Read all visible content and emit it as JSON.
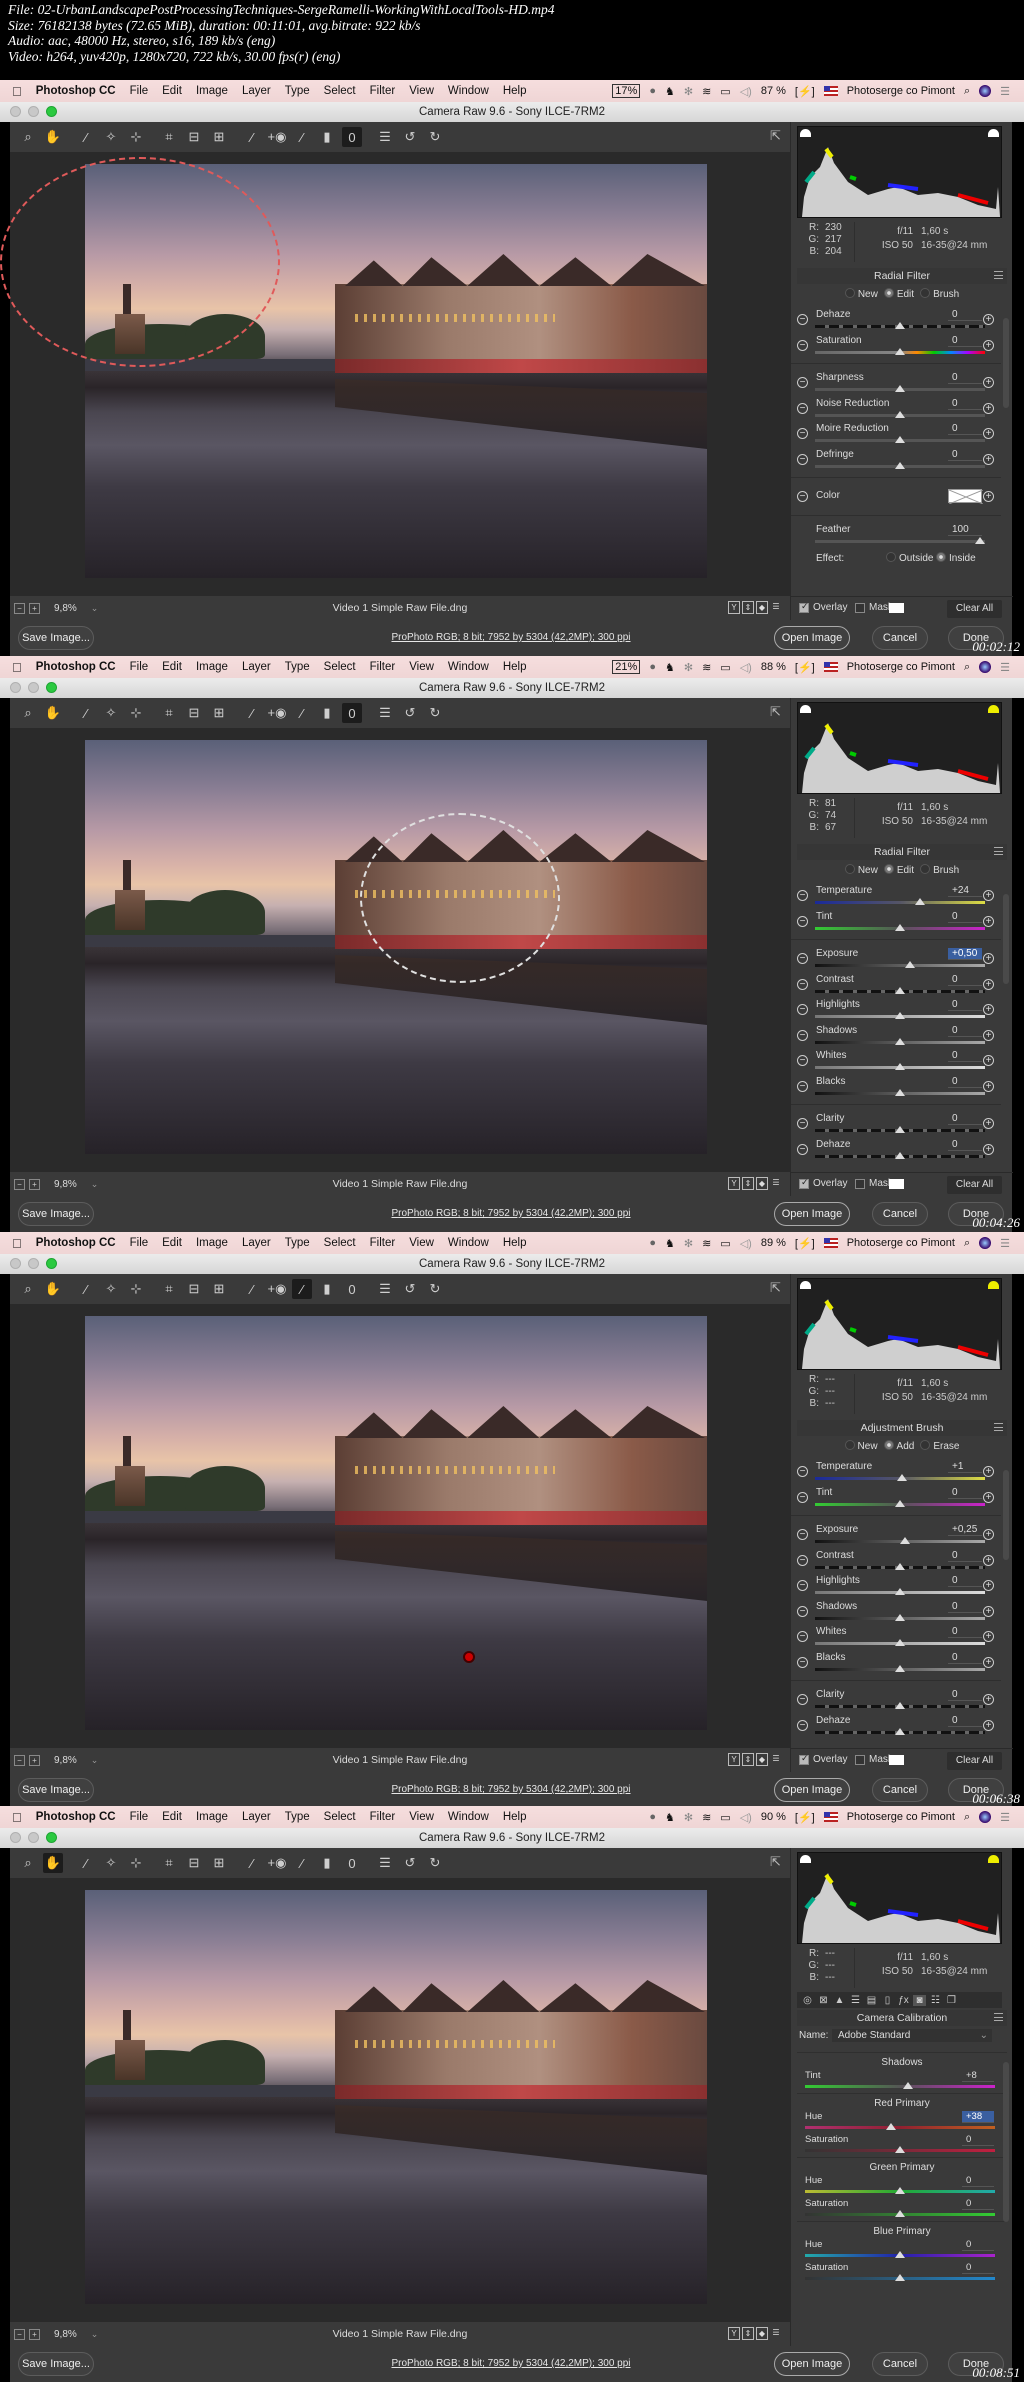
{
  "file_info": {
    "lines": [
      "File: 02-UrbanLandscapePostProcessingTechniques-SergeRamelli-WorkingWithLocalTools-HD.mp4",
      "Size: 76182138 bytes (72.65 MiB), duration: 00:11:01, avg.bitrate: 922 kb/s",
      "Audio: aac, 48000 Hz, stereo, s16, 189 kb/s (eng)",
      "Video: h264, yuv420p, 1280x720, 722 kb/s, 30.00 fps(r) (eng)"
    ]
  },
  "common": {
    "app_name": "Photoshop CC",
    "menu": [
      "File",
      "Edit",
      "Image",
      "Layer",
      "Type",
      "Select",
      "Filter",
      "View",
      "Window",
      "Help"
    ],
    "user": "Photoserge co Pimont",
    "window_title": "Camera Raw 9.6  -  Sony ILCE-7RM2",
    "zoom_level": "9,8%",
    "filename": "Video 1 Simple Raw File.dng",
    "workflow": "ProPhoto RGB; 8 bit; 7952 by 5304 (42,2MP); 300 ppi",
    "save_label": "Save Image...",
    "open_label": "Open Image",
    "cancel_label": "Cancel",
    "done_label": "Done",
    "overlay_label": "Overlay",
    "mask_label": "Mask",
    "clear_all_label": "Clear All",
    "exif": {
      "aperture": "f/11",
      "shutter": "1,60 s",
      "iso": "ISO 50",
      "lens": "16-35@24 mm"
    },
    "tools": [
      "zoom",
      "hand",
      "white-balance",
      "color-sampler",
      "targeted-adjustment",
      "crop",
      "straighten",
      "transform",
      "spot-removal",
      "red-eye",
      "adjustment-brush",
      "graduated-filter",
      "radial-filter",
      "preferences",
      "rotate-ccw",
      "rotate-cw"
    ]
  },
  "frames": [
    {
      "timestamp": "00:02:12",
      "cpu": "17%",
      "battery": "87 %",
      "active_tool": "radial-filter",
      "rgb": {
        "r": "230",
        "g": "217",
        "b": "204"
      },
      "panel_title": "Radial Filter",
      "modes": [
        {
          "label": "New",
          "on": false
        },
        {
          "label": "Edit",
          "on": true
        },
        {
          "label": "Brush",
          "on": false
        }
      ],
      "sliders": [
        {
          "label": "Dehaze",
          "value": "0",
          "pos": 0.5,
          "track": "contrast"
        },
        {
          "label": "Saturation",
          "value": "0",
          "pos": 0.5,
          "track": "saturation"
        },
        {
          "sep": true
        },
        {
          "label": "Sharpness",
          "value": "0",
          "pos": 0.5,
          "track": "plain"
        },
        {
          "label": "Noise Reduction",
          "value": "0",
          "pos": 0.5,
          "track": "plain"
        },
        {
          "label": "Moire Reduction",
          "value": "0",
          "pos": 0.5,
          "track": "plain"
        },
        {
          "label": "Defringe",
          "value": "0",
          "pos": 0.5,
          "track": "plain"
        },
        {
          "sep": true
        }
      ],
      "color_label": "Color",
      "feather_label": "Feather",
      "feather_value": "100",
      "effect_label": "Effect:",
      "effect_options": [
        {
          "label": "Outside",
          "on": false
        },
        {
          "label": "Inside",
          "on": true
        }
      ],
      "overlay_checked": true
    },
    {
      "timestamp": "00:04:26",
      "cpu": "21%",
      "battery": "88 %",
      "active_tool": "radial-filter",
      "rgb": {
        "r": "81",
        "g": "74",
        "b": "67"
      },
      "panel_title": "Radial Filter",
      "modes": [
        {
          "label": "New",
          "on": false
        },
        {
          "label": "Edit",
          "on": true
        },
        {
          "label": "Brush",
          "on": false
        }
      ],
      "sliders": [
        {
          "label": "Temperature",
          "value": "+24",
          "pos": 0.62,
          "track": "temp"
        },
        {
          "label": "Tint",
          "value": "0",
          "pos": 0.5,
          "track": "tint"
        },
        {
          "sep": true
        },
        {
          "label": "Exposure",
          "value": "+0,50",
          "pos": 0.56,
          "track": "dark",
          "selected": true
        },
        {
          "label": "Contrast",
          "value": "0",
          "pos": 0.5,
          "track": "contrast"
        },
        {
          "label": "Highlights",
          "value": "0",
          "pos": 0.5,
          "track": "light"
        },
        {
          "label": "Shadows",
          "value": "0",
          "pos": 0.5,
          "track": "dark"
        },
        {
          "label": "Whites",
          "value": "0",
          "pos": 0.5,
          "track": "light"
        },
        {
          "label": "Blacks",
          "value": "0",
          "pos": 0.5,
          "track": "dark"
        },
        {
          "sep": true
        },
        {
          "label": "Clarity",
          "value": "0",
          "pos": 0.5,
          "track": "contrast"
        },
        {
          "label": "Dehaze",
          "value": "0",
          "pos": 0.5,
          "track": "contrast"
        }
      ],
      "overlay_checked": true
    },
    {
      "timestamp": "00:06:38",
      "cpu": "",
      "battery": "89 %",
      "active_tool": "adjustment-brush",
      "rgb": {
        "r": "---",
        "g": "---",
        "b": "---"
      },
      "panel_title": "Adjustment Brush",
      "modes": [
        {
          "label": "New",
          "on": false
        },
        {
          "label": "Add",
          "on": true
        },
        {
          "label": "Erase",
          "on": false
        }
      ],
      "sliders": [
        {
          "label": "Temperature",
          "value": "+1",
          "pos": 0.51,
          "track": "temp"
        },
        {
          "label": "Tint",
          "value": "0",
          "pos": 0.5,
          "track": "tint"
        },
        {
          "sep": true
        },
        {
          "label": "Exposure",
          "value": "+0,25",
          "pos": 0.53,
          "track": "dark"
        },
        {
          "label": "Contrast",
          "value": "0",
          "pos": 0.5,
          "track": "contrast"
        },
        {
          "label": "Highlights",
          "value": "0",
          "pos": 0.5,
          "track": "light"
        },
        {
          "label": "Shadows",
          "value": "0",
          "pos": 0.5,
          "track": "dark"
        },
        {
          "label": "Whites",
          "value": "0",
          "pos": 0.5,
          "track": "light"
        },
        {
          "label": "Blacks",
          "value": "0",
          "pos": 0.5,
          "track": "dark"
        },
        {
          "sep": true
        },
        {
          "label": "Clarity",
          "value": "0",
          "pos": 0.5,
          "track": "contrast"
        },
        {
          "label": "Dehaze",
          "value": "0",
          "pos": 0.5,
          "track": "contrast"
        }
      ],
      "overlay_checked": true
    },
    {
      "timestamp": "00:08:51",
      "cpu": "",
      "battery": "90 %",
      "active_tool": "hand",
      "rgb": {
        "r": "---",
        "g": "---",
        "b": "---"
      },
      "panel_title": "Camera Calibration",
      "panel_tabs": [
        "basic",
        "tone-curve",
        "detail",
        "hsl",
        "split-toning",
        "lens",
        "fx",
        "camera-calibration",
        "presets",
        "snapshots"
      ],
      "active_panel_tab": "camera-calibration",
      "name_label": "Name:",
      "name_value": "Adobe Standard",
      "calibration": [
        {
          "group": "Shadows",
          "rows": [
            {
              "label": "Tint",
              "value": "+8",
              "pos": 0.54,
              "track": "tint"
            }
          ]
        },
        {
          "group": "Red Primary",
          "rows": [
            {
              "label": "Hue",
              "value": "+38",
              "pos": 0.45,
              "track": "redhue",
              "selected": true
            },
            {
              "label": "Saturation",
              "value": "0",
              "pos": 0.5,
              "track": "redsat"
            }
          ]
        },
        {
          "group": "Green Primary",
          "rows": [
            {
              "label": "Hue",
              "value": "0",
              "pos": 0.5,
              "track": "greenhue"
            },
            {
              "label": "Saturation",
              "value": "0",
              "pos": 0.5,
              "track": "greensat"
            }
          ]
        },
        {
          "group": "Blue Primary",
          "rows": [
            {
              "label": "Hue",
              "value": "0",
              "pos": 0.5,
              "track": "bluehue"
            },
            {
              "label": "Saturation",
              "value": "0",
              "pos": 0.5,
              "track": "bluesat"
            }
          ]
        }
      ]
    }
  ]
}
